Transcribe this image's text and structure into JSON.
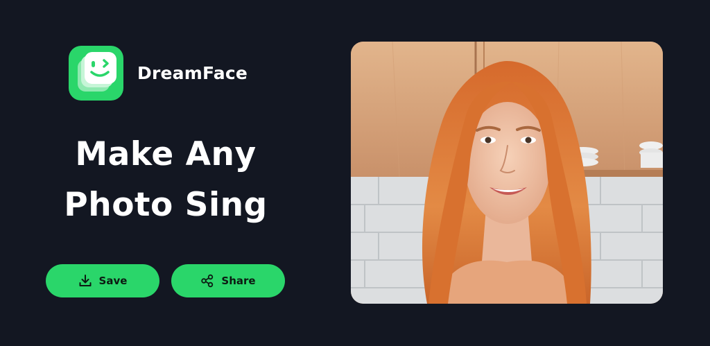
{
  "brand": {
    "name": "DreamFace",
    "logo_icon": "smiling-face-wink-icon",
    "accent": "#2ad66a"
  },
  "headline": {
    "line1": "Make Any",
    "line2": "Photo Sing"
  },
  "actions": {
    "save_label": "Save",
    "save_icon": "download-icon",
    "share_label": "Share",
    "share_icon": "share-icon"
  },
  "colors": {
    "background": "#131722",
    "accent": "#2ad66a",
    "text": "#ffffff"
  }
}
